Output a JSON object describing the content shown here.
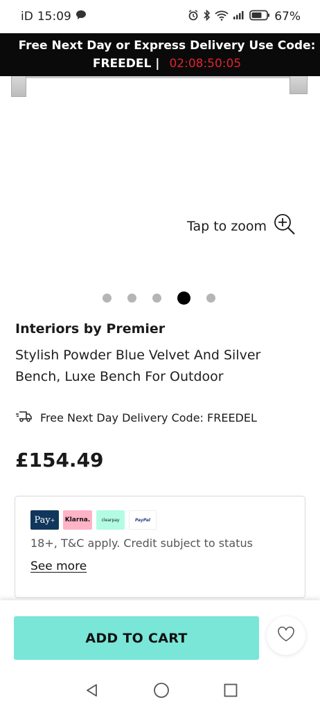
{
  "status_bar": {
    "carrier": "iD",
    "time": "15:09",
    "battery": "67%"
  },
  "promo": {
    "headline": "Free Next Day or Express Delivery Use Code:",
    "code": "FREEDEL |",
    "countdown": "02:08:50:05",
    "countdown_color": "#e0242e"
  },
  "gallery": {
    "zoom_label": "Tap to zoom",
    "dot_count": 5,
    "active_dot": 4
  },
  "product": {
    "brand": "Interiors by Premier",
    "title": "Stylish Powder Blue Velvet And Silver Bench, Luxe Bench For Outdoor",
    "delivery_text": "Free Next Day Delivery Code: FREEDEL",
    "price": "£154.49"
  },
  "finance": {
    "logos": {
      "pay": "Pay",
      "klarna": "Klarna.",
      "clearpay": "clearpay",
      "paypal": "PayPal"
    },
    "terms": "18+, T&C apply. Credit subject to status",
    "see_more": "See more"
  },
  "actions": {
    "add_to_cart": "ADD TO CART",
    "accent_color": "#7ae6d8"
  },
  "icons": {
    "zoom": "zoom-in-icon",
    "delivery": "delivery-truck-icon",
    "wishlist": "heart-icon",
    "nav_back": "back-triangle-icon",
    "nav_home": "home-circle-icon",
    "nav_recents": "recents-square-icon"
  }
}
